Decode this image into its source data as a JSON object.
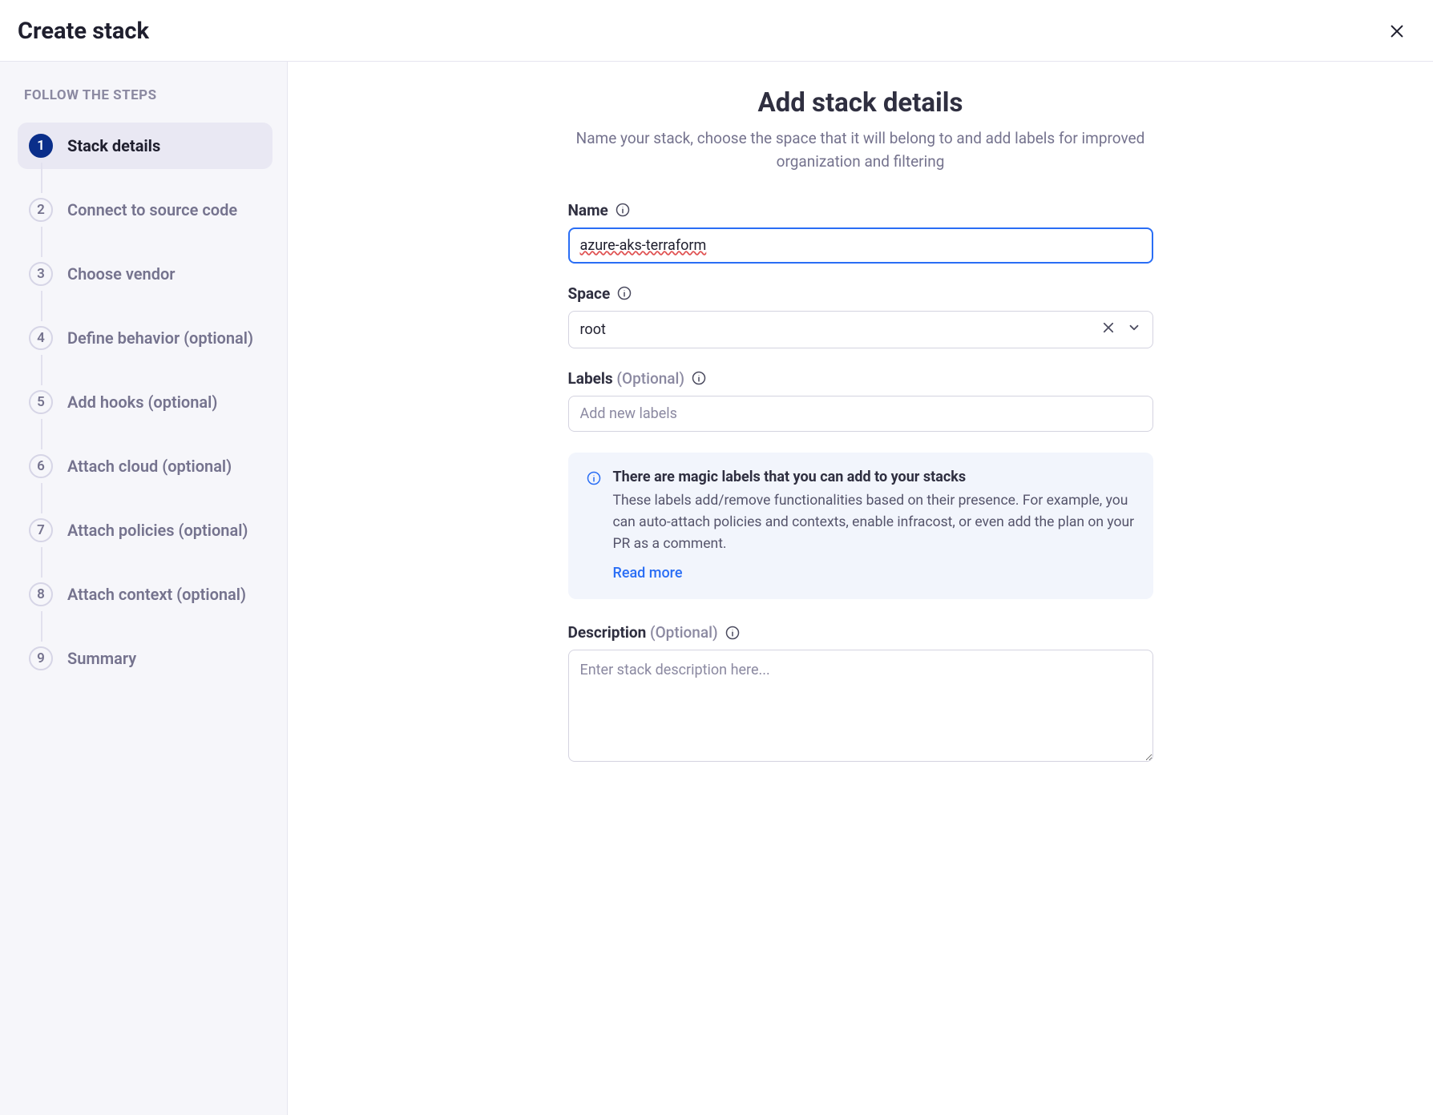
{
  "header": {
    "title": "Create stack"
  },
  "sidebar": {
    "heading": "FOLLOW THE STEPS",
    "steps": [
      {
        "num": "1",
        "label": "Stack details",
        "active": true
      },
      {
        "num": "2",
        "label": "Connect to source code",
        "active": false
      },
      {
        "num": "3",
        "label": "Choose vendor",
        "active": false
      },
      {
        "num": "4",
        "label": "Define behavior (optional)",
        "active": false
      },
      {
        "num": "5",
        "label": "Add hooks (optional)",
        "active": false
      },
      {
        "num": "6",
        "label": "Attach cloud (optional)",
        "active": false
      },
      {
        "num": "7",
        "label": "Attach policies (optional)",
        "active": false
      },
      {
        "num": "8",
        "label": "Attach context (optional)",
        "active": false
      },
      {
        "num": "9",
        "label": "Summary",
        "active": false
      }
    ]
  },
  "main": {
    "title": "Add stack details",
    "subtitle": "Name your stack, choose the space that it will belong to and add labels for improved organization and filtering",
    "name": {
      "label": "Name",
      "value": "azure-aks-terraform"
    },
    "space": {
      "label": "Space",
      "value": "root"
    },
    "labels": {
      "label": "Labels",
      "optional": "(Optional)",
      "placeholder": "Add new labels"
    },
    "callout": {
      "title": "There are magic labels that you can add to your stacks",
      "body": "These labels add/remove functionalities based on their presence. For example, you can auto-attach policies and contexts, enable infracost, or even add the plan on your PR as a comment.",
      "link": "Read more"
    },
    "description": {
      "label": "Description",
      "optional": "(Optional)",
      "placeholder": "Enter stack description here..."
    }
  }
}
